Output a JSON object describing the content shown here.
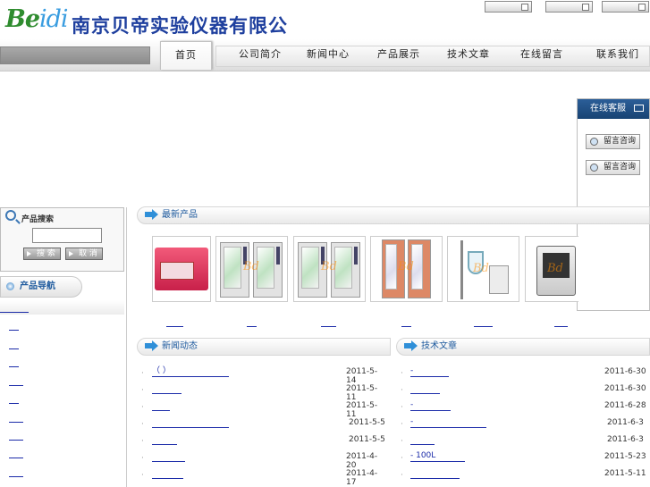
{
  "header": {
    "logo_text_a": "Be",
    "logo_text_b": "idi",
    "company_name": "南京贝帝实验仪器有限公司"
  },
  "nav": {
    "items": [
      "首页",
      "公司简介",
      "新闻中心",
      "产品展示",
      "技术文章",
      "在线留言",
      "联系我们"
    ]
  },
  "service": {
    "title": "在线客服",
    "buttons": [
      "留言咨询",
      "留言咨询"
    ]
  },
  "search": {
    "title": "产品搜索",
    "input_value": "",
    "search_label": "搜 索",
    "cancel_label": "取 消"
  },
  "product_nav": {
    "title": "产品导航"
  },
  "latest_products": {
    "title": "最新产品"
  },
  "news": {
    "title": "新闻动态",
    "items": [
      {
        "title": "（                  ）",
        "date": "2011-5-14"
      },
      {
        "title": "",
        "date": "2011-5-11"
      },
      {
        "title": "",
        "date": "2011-5-11"
      },
      {
        "title": "",
        "date": "2011-5-5"
      },
      {
        "title": "",
        "date": "2011-5-5"
      },
      {
        "title": "",
        "date": "2011-4-20"
      },
      {
        "title": "",
        "date": "2011-4-17"
      }
    ]
  },
  "articles": {
    "title": "技术文章",
    "items": [
      {
        "title": "     -",
        "date": "2011-6-30"
      },
      {
        "title": "",
        "date": "2011-6-30"
      },
      {
        "title": "        -",
        "date": "2011-6-28"
      },
      {
        "title": "              -",
        "date": "2011-6-3"
      },
      {
        "title": "",
        "date": "2011-6-3"
      },
      {
        "title": "   - 100L",
        "date": "2011-5-23"
      },
      {
        "title": "",
        "date": "2011-5-11"
      }
    ]
  }
}
